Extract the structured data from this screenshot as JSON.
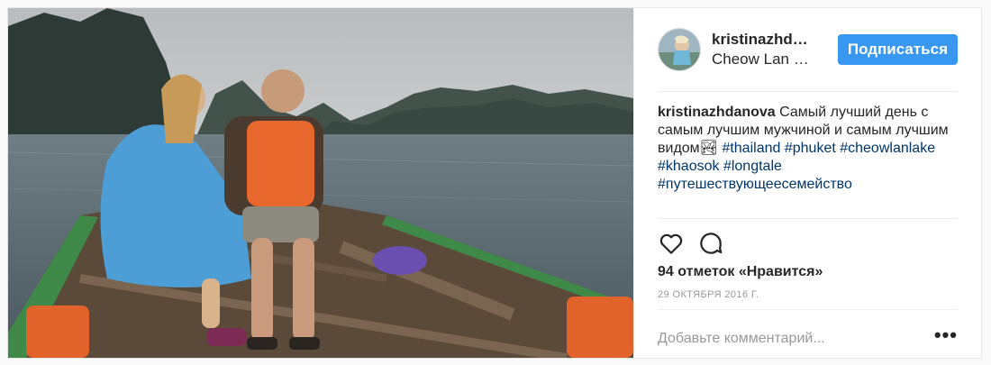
{
  "post": {
    "username": "kristinazhd…",
    "location": "Cheow Lan …",
    "follow_label": "Подписаться",
    "caption_user": "kristinazhdanova",
    "caption_text": "Самый лучший день с самым лучшим мужчиной и самым лучшим видом",
    "caption_emoji": "🏞",
    "hashtags": [
      "#thailand",
      "#phuket",
      "#cheowlanlake",
      "#khaosok",
      "#longtale",
      "#путешествующеесемейство"
    ],
    "likes": "94 отметок «Нравится»",
    "date": "29 ОКТЯБРЯ 2016 Г.",
    "comment_placeholder": "Добавьте комментарий...",
    "more_label": "•••"
  },
  "colors": {
    "follow_bg": "#3897f0",
    "hashtag": "#003569",
    "muted": "#999999"
  },
  "icons": [
    "heart-icon",
    "comment-icon",
    "more-icon"
  ]
}
